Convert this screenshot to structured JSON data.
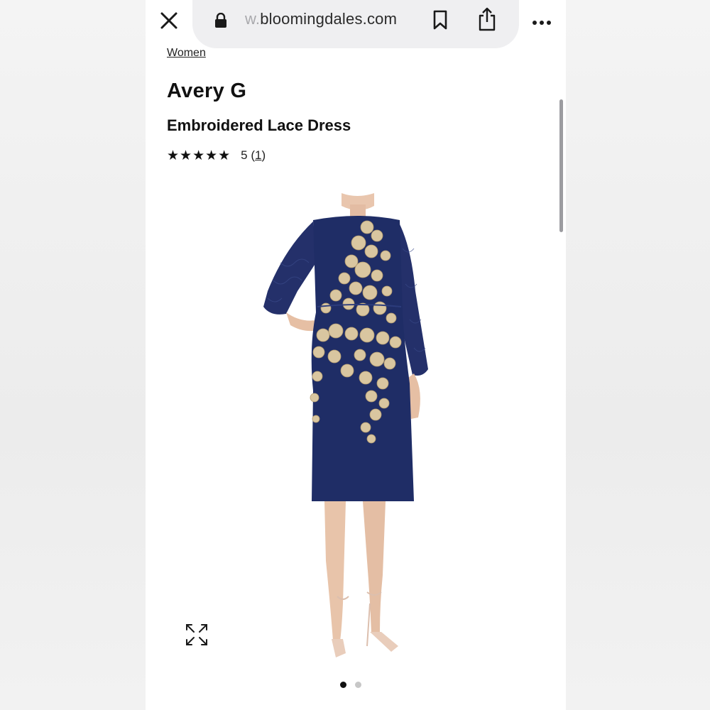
{
  "browser": {
    "url_prefix": "w.",
    "url_domain": "bloomingdales.com",
    "icons": [
      "close-icon",
      "lock-icon",
      "bookmark-icon",
      "share-icon",
      "more-icon"
    ]
  },
  "breadcrumb": "Women",
  "product": {
    "brand": "Avery G",
    "name": "Embroidered Lace Dress",
    "stars": "★★★★★",
    "rating": "5",
    "review_open": "(",
    "review_count": "1",
    "review_close": ")"
  },
  "gallery": {
    "image_subject": "model wearing navy embroidered lace dress with gold floral appliqué",
    "dots": [
      "active",
      "inactive"
    ],
    "expand_icon": "expand-arrows-icon"
  },
  "colors": {
    "dress_navy": "#1f2d66",
    "embroidery_gold": "#d9c6a0",
    "text": "#111111"
  }
}
